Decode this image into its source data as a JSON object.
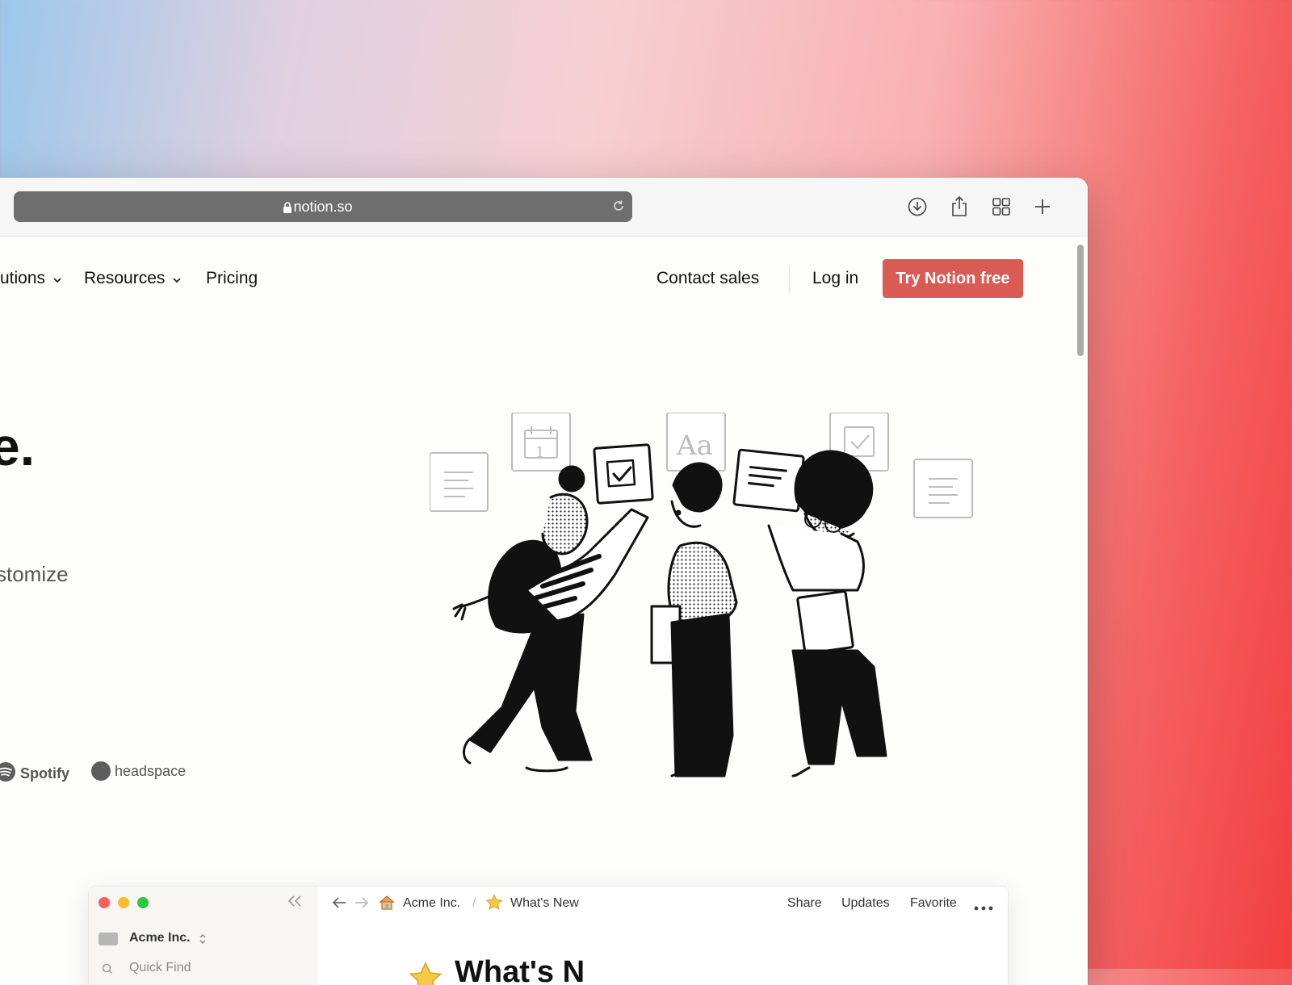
{
  "browser": {
    "url": "notion.so",
    "toolbar_icons": [
      "download-icon",
      "share-icon",
      "tabs-overview-icon",
      "new-tab-icon"
    ]
  },
  "nav": {
    "solutions_label": "utions",
    "resources_label": "Resources",
    "pricing_label": "Pricing",
    "contact_sales_label": "Contact sales",
    "login_label": "Log in",
    "cta_label": "Try Notion free"
  },
  "hero": {
    "title_partial": "e.",
    "subtitle_partial": "stomize"
  },
  "logos": {
    "spotify": "Spotify",
    "headspace": "headspace"
  },
  "app_preview": {
    "workspace_name": "Acme Inc.",
    "quick_find": "Quick Find",
    "breadcrumb_home": "Acme Inc.",
    "breadcrumb_separator": "/",
    "breadcrumb_page": "What's New",
    "actions": {
      "share": "Share",
      "updates": "Updates",
      "favorite": "Favorite"
    },
    "page_title_partial": "What's N"
  },
  "colors": {
    "cta": "#d95b53",
    "traffic_red": "#fe5f57",
    "traffic_yellow": "#febc2e",
    "traffic_green": "#28c840"
  }
}
